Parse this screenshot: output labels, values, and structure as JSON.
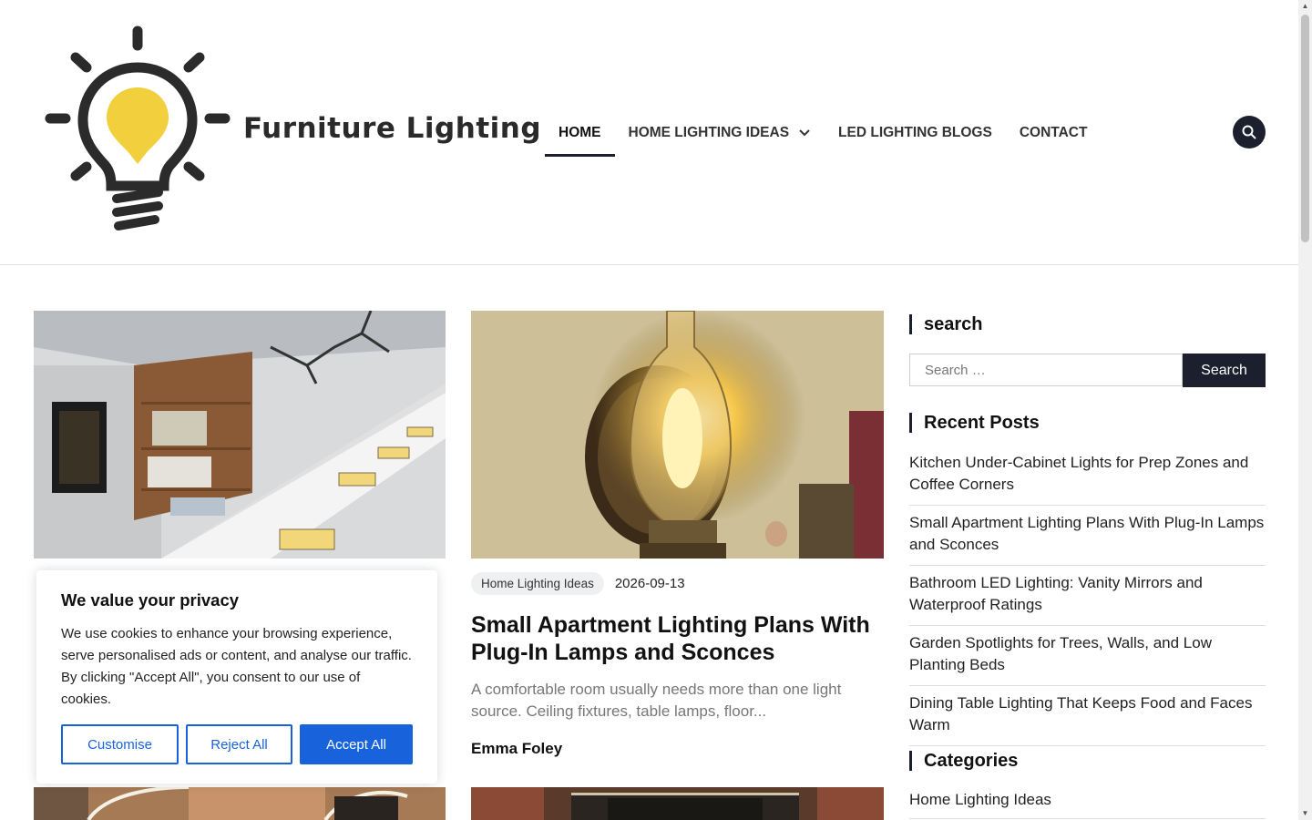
{
  "site": {
    "title": "Furniture Lighting",
    "accent_color": "#1b1f2e",
    "logo_icon": "lightbulb-icon"
  },
  "nav": {
    "items": [
      {
        "label": "Home",
        "active": true
      },
      {
        "label": "Home Lighting Ideas",
        "has_dropdown": true
      },
      {
        "label": "LED Lighting Blogs"
      },
      {
        "label": "Contact"
      }
    ],
    "search_icon": "search-icon"
  },
  "posts": [
    {
      "category": "Home Lighting Ideas",
      "date": "2026-09-13",
      "title": "Small Apartment Lighting Plans With Plug-In Lamps and Sconces",
      "excerpt": "A comfortable room usually needs more than one light source. Ceiling fixtures, table lamps, floor...",
      "author": "Emma Foley"
    }
  ],
  "sidebar": {
    "search": {
      "title": "search",
      "placeholder": "Search …",
      "button": "Search"
    },
    "recent_posts": {
      "title": "Recent Posts",
      "items": [
        "Kitchen Under-Cabinet Lights for Prep Zones and Coffee Corners",
        "Small Apartment Lighting Plans With Plug-In Lamps and Sconces",
        "Bathroom LED Lighting: Vanity Mirrors and Waterproof Ratings",
        "Garden Spotlights for Trees, Walls, and Low Planting Beds",
        "Dining Table Lighting That Keeps Food and Faces Warm"
      ]
    },
    "categories": {
      "title": "Categories",
      "items": [
        "Home Lighting Ideas"
      ]
    }
  },
  "cookie_banner": {
    "title": "We value your privacy",
    "text": "We use cookies to enhance your browsing experience, serve personalised ads or content, and analyse our traffic. By clicking \"Accept All\", you consent to our use of cookies.",
    "customise": "Customise",
    "reject": "Reject All",
    "accept": "Accept All",
    "button_color": "#1863dc"
  }
}
